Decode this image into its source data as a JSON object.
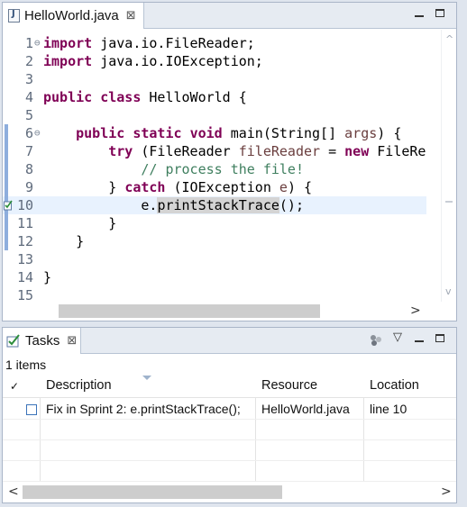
{
  "editor": {
    "tab_title": "HelloWorld.java",
    "close_glyph": "⊠",
    "code_lines": [
      {
        "num": "1",
        "fold": "⊖",
        "html": "<span class='kw'>import</span> java.io.FileReader;"
      },
      {
        "num": "2",
        "fold": "",
        "html": "<span class='kw'>import</span> java.io.IOException;"
      },
      {
        "num": "3",
        "fold": "",
        "html": ""
      },
      {
        "num": "4",
        "fold": "",
        "html": "<span class='kw'>public</span> <span class='kw'>class</span> HelloWorld {"
      },
      {
        "num": "5",
        "fold": "",
        "html": ""
      },
      {
        "num": "6",
        "fold": "⊖",
        "html": "    <span class='kw'>public</span> <span class='kw'>static</span> <span class='kw'>void</span> main(String[] <span class='var'>args</span>) {"
      },
      {
        "num": "7",
        "fold": "",
        "html": "        <span class='kw'>try</span> (FileReader <span class='var'>fileReader</span> = <span class='kw'>new</span> FileRe"
      },
      {
        "num": "8",
        "fold": "",
        "html": "            <span class='cm'>// process the file!</span>"
      },
      {
        "num": "9",
        "fold": "",
        "html": "        } <span class='kw'>catch</span> (IOException <span class='var'>e</span>) {"
      },
      {
        "num": "10",
        "fold": "",
        "html": "            e.<span class='hl'>printStackTrace</span>();"
      },
      {
        "num": "11",
        "fold": "",
        "html": "        }"
      },
      {
        "num": "12",
        "fold": "",
        "html": "    }"
      },
      {
        "num": "13",
        "fold": "",
        "html": ""
      },
      {
        "num": "14",
        "fold": "",
        "html": "}"
      },
      {
        "num": "15",
        "fold": "",
        "html": ""
      }
    ],
    "current_line": 10
  },
  "tasks": {
    "tab_title": "Tasks",
    "close_glyph": "⊠",
    "items_count": "1 items",
    "columns": {
      "check": "✓",
      "description": "Description",
      "resource": "Resource",
      "location": "Location"
    },
    "rows": [
      {
        "description": "Fix in Sprint 2: e.printStackTrace();",
        "resource": "HelloWorld.java",
        "location": "line 10"
      }
    ]
  },
  "icons": {
    "scroll_left": "<",
    "scroll_right": ">",
    "scroll_up": "^",
    "scroll_down": "v",
    "view_menu": "▽"
  },
  "colors": {
    "keyword": "#7f0055",
    "comment": "#3f7f5f",
    "variable": "#6a3e3e",
    "current_line": "#e8f2fe"
  }
}
